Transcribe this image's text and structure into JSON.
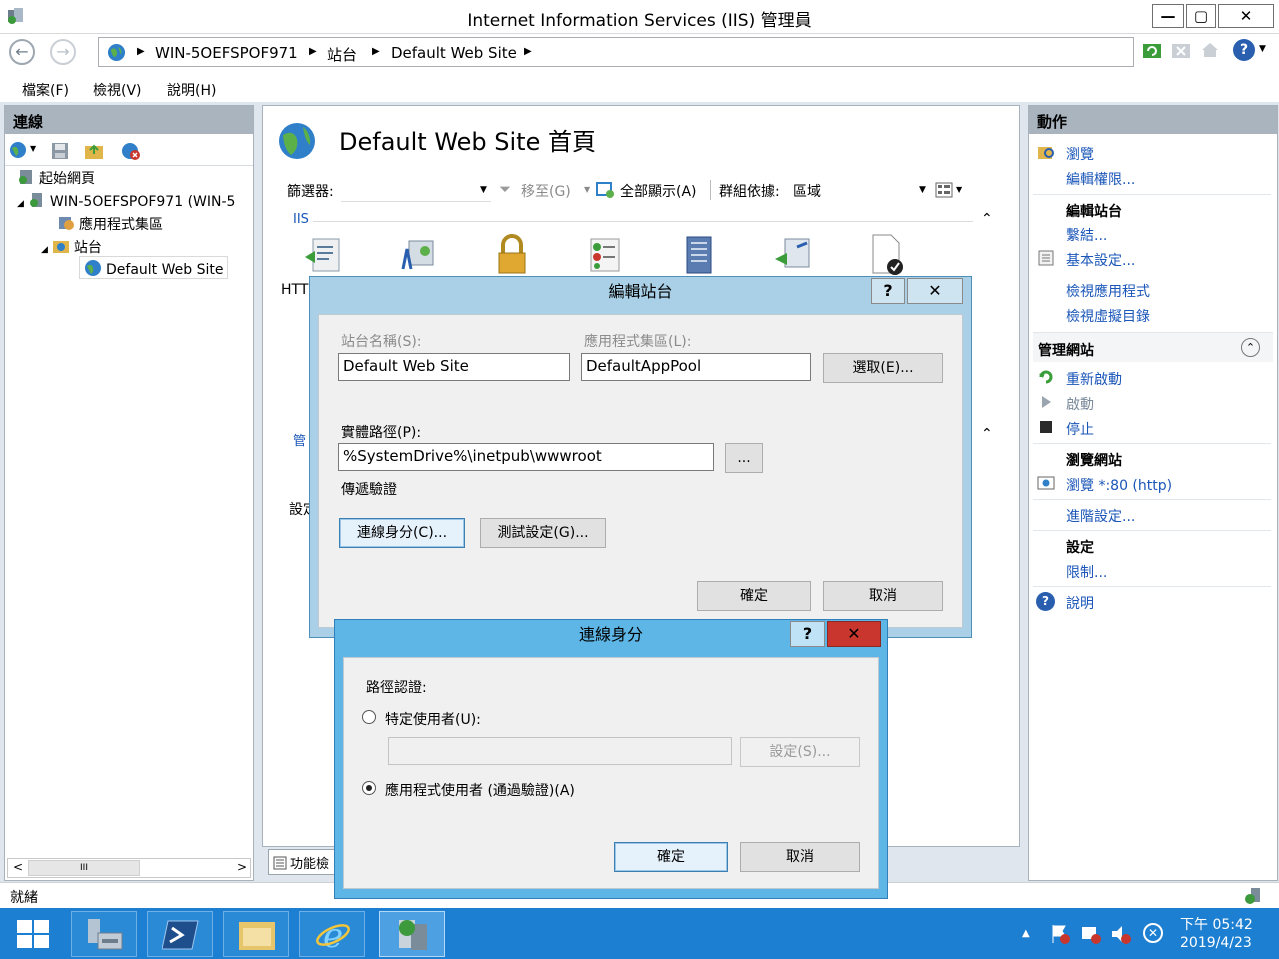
{
  "window": {
    "title": "Internet Information Services (IIS) 管理員",
    "min_glyph": "—",
    "max_glyph": "▢",
    "close_glyph": "✕"
  },
  "address": {
    "back_glyph": "←",
    "forward_glyph": "→",
    "crumbs": [
      "WIN-5OEFSPOF971",
      "站台",
      "Default Web Site"
    ],
    "arrow": "▶",
    "help_glyph": "?"
  },
  "menu": {
    "file": "檔案(F)",
    "view": "檢視(V)",
    "help": "說明(H)"
  },
  "connections": {
    "title": "連線",
    "tree": {
      "start_page": "起始網頁",
      "server": "WIN-5OEFSPOF971 (WIN-5",
      "app_pools": "應用程式集區",
      "sites": "站台",
      "default_site": "Default Web Site"
    },
    "scroll_left": "<",
    "scroll_right": ">",
    "scroll_grip": "III"
  },
  "center": {
    "title": "Default Web Site 首頁",
    "filter_label": "篩選器:",
    "go_label": "移至(G)",
    "show_all_label": "全部顯示(A)",
    "group_by_label": "群組依據:",
    "group_by_value": "區域",
    "section_iis": "IIS",
    "partial_http": "HTT",
    "partial_manage": "管",
    "partial_settings": "設定",
    "features_view_tab": "功能檢"
  },
  "actions": {
    "title": "動作",
    "explore": "瀏覽",
    "edit_permissions": "編輯權限...",
    "edit_site": "編輯站台",
    "bindings": "繫結...",
    "basic_settings": "基本設定...",
    "view_apps": "檢視應用程式",
    "view_vdirs": "檢視虛擬目錄",
    "manage_site": "管理網站",
    "restart": "重新啟動",
    "start": "啟動",
    "stop": "停止",
    "browse_site": "瀏覽網站",
    "browse_80": "瀏覽 *:80 (http)",
    "advanced": "進階設定...",
    "configure": "設定",
    "limits": "限制...",
    "help": "說明"
  },
  "status": {
    "ready": "就緒"
  },
  "taskbar": {
    "time": "下午 05:42",
    "date": "2019/4/23"
  },
  "edit_site_dialog": {
    "title": "編輯站台",
    "help_glyph": "?",
    "close_glyph": "✕",
    "site_name_label": "站台名稱(S):",
    "site_name_value": "Default Web Site",
    "app_pool_label": "應用程式集區(L):",
    "app_pool_value": "DefaultAppPool",
    "select_button": "選取(E)...",
    "physical_path_label": "實體路徑(P):",
    "physical_path_value": "%SystemDrive%\\inetpub\\wwwroot",
    "browse_button": "...",
    "pass_through_label": "傳遞驗證",
    "connect_as_button": "連線身分(C)...",
    "test_settings_button": "測試設定(G)...",
    "ok_button": "確定",
    "cancel_button": "取消"
  },
  "connect_as_dialog": {
    "title": "連線身分",
    "help_glyph": "?",
    "close_glyph": "✕",
    "path_credentials_label": "路徑認證:",
    "specific_user_label": "特定使用者(U):",
    "set_button": "設定(S)...",
    "app_user_label": "應用程式使用者 (通過驗證)(A)",
    "ok_button": "確定",
    "cancel_button": "取消"
  },
  "colors": {
    "taskbar": "#1d7fd1",
    "dialog_title": "#a9d0e6",
    "active_dialog_title": "#5eb6e6",
    "close_red": "#c9362d",
    "link_blue": "#1a56b8"
  }
}
